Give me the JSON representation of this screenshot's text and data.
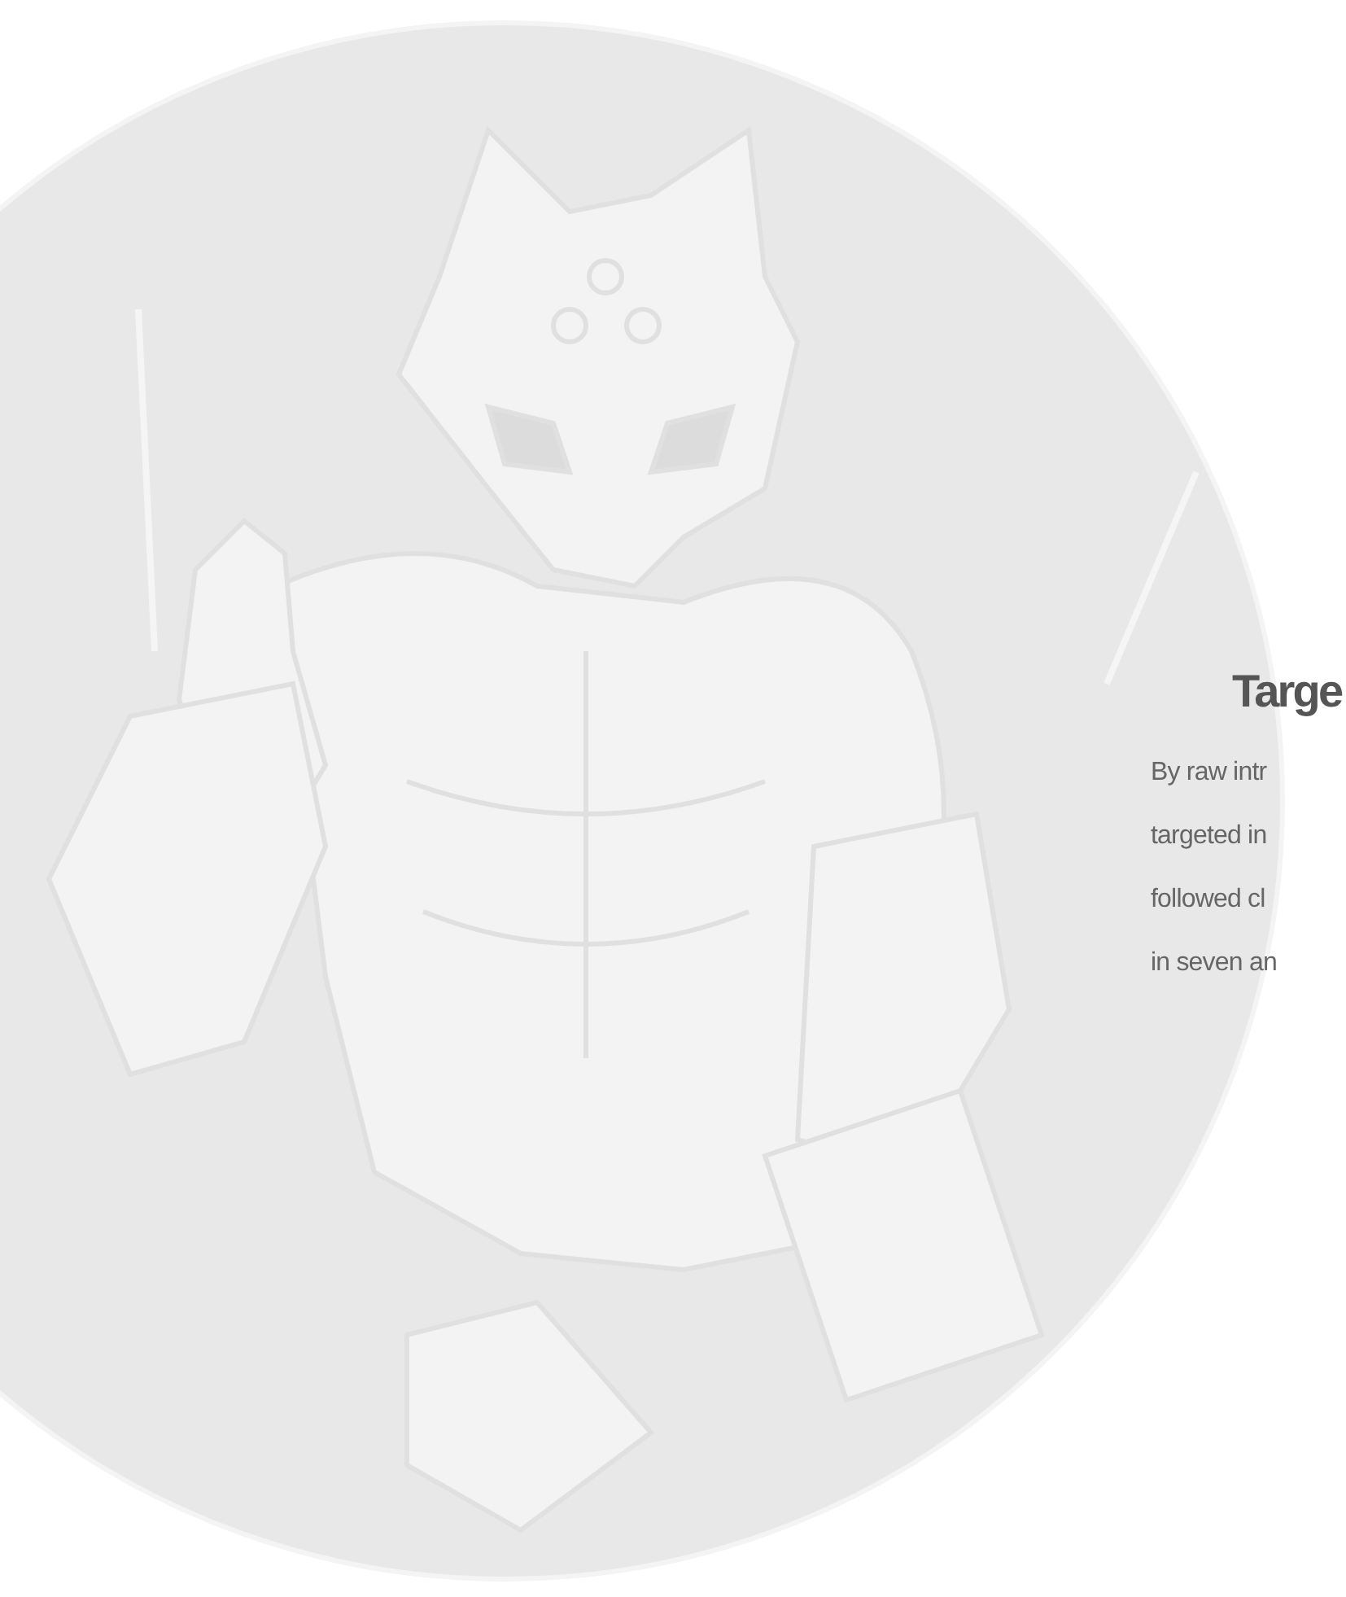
{
  "section": {
    "heading": "Targe",
    "paragraph_lines": [
      "By raw intr",
      "targeted in",
      "followed cl",
      "in seven an"
    ]
  }
}
